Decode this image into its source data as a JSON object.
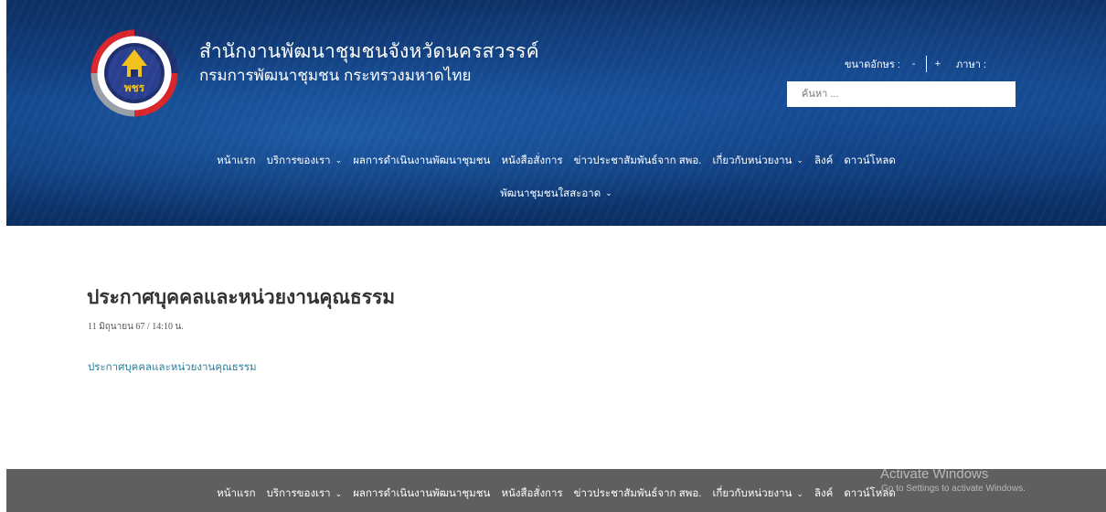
{
  "header": {
    "title": "สำนักงานพัฒนาชุมชนจังหวัดนครสวรรค์",
    "subtitle": "กรมการพัฒนาชุมชน กระทรวงมหาดไทย",
    "logo_text": "พชร"
  },
  "tools": {
    "font_size_label": "ขนาดอักษร :",
    "decrease": "-",
    "increase": "+",
    "language_label": "ภาษา :"
  },
  "search": {
    "placeholder": "ค้นหา ..."
  },
  "nav": {
    "items": [
      {
        "label": "หน้าแรก",
        "has_dropdown": false
      },
      {
        "label": "บริการของเรา",
        "has_dropdown": true
      },
      {
        "label": "ผลการดำเนินงานพัฒนาชุมชน",
        "has_dropdown": false
      },
      {
        "label": "หนังสือสั่งการ",
        "has_dropdown": false
      },
      {
        "label": "ข่าวประชาสัมพันธ์จาก สพอ.",
        "has_dropdown": false
      },
      {
        "label": "เกี่ยวกับหน่วยงาน",
        "has_dropdown": true
      },
      {
        "label": "ลิงค์",
        "has_dropdown": false
      },
      {
        "label": "ดาวน์โหลด",
        "has_dropdown": false
      },
      {
        "label": "พัฒนาชุมชนใสสะอาด",
        "has_dropdown": true
      }
    ],
    "chevron": "⌄"
  },
  "content": {
    "title": "ประกาศบุคคลและหน่วยงานคุณธรรม",
    "date": "11 มิถุนายน 67 / 14:10 น.",
    "link_text": "ประกาศบุคคลและหน่วยงานคุณธรรม"
  },
  "footer_nav": {
    "items": [
      "หน้าแรก",
      "บริการของเรา",
      "ผลการดำเนินงานพัฒนาชุมชน",
      "หนังสือสั่งการ",
      "ข่าวประชาสัมพันธ์จาก สพอ.",
      "เกี่ยวกับหน่วยงาน",
      "ลิงค์",
      "ดาวน์โหลด"
    ]
  },
  "watermark": {
    "line1": "Activate Windows",
    "line2": "Go to Settings to activate Windows."
  },
  "colors": {
    "header_dark": "#0d2f63",
    "header_mid": "#124488",
    "footer": "#5f5f5f",
    "link": "#2a7f9a",
    "logo_red": "#d9262b",
    "logo_navy": "#1e2f6e",
    "logo_gold": "#f2c21a"
  },
  "icons": {
    "logo": "cdd-emblem-icon",
    "chevron": "chevron-down-icon"
  }
}
